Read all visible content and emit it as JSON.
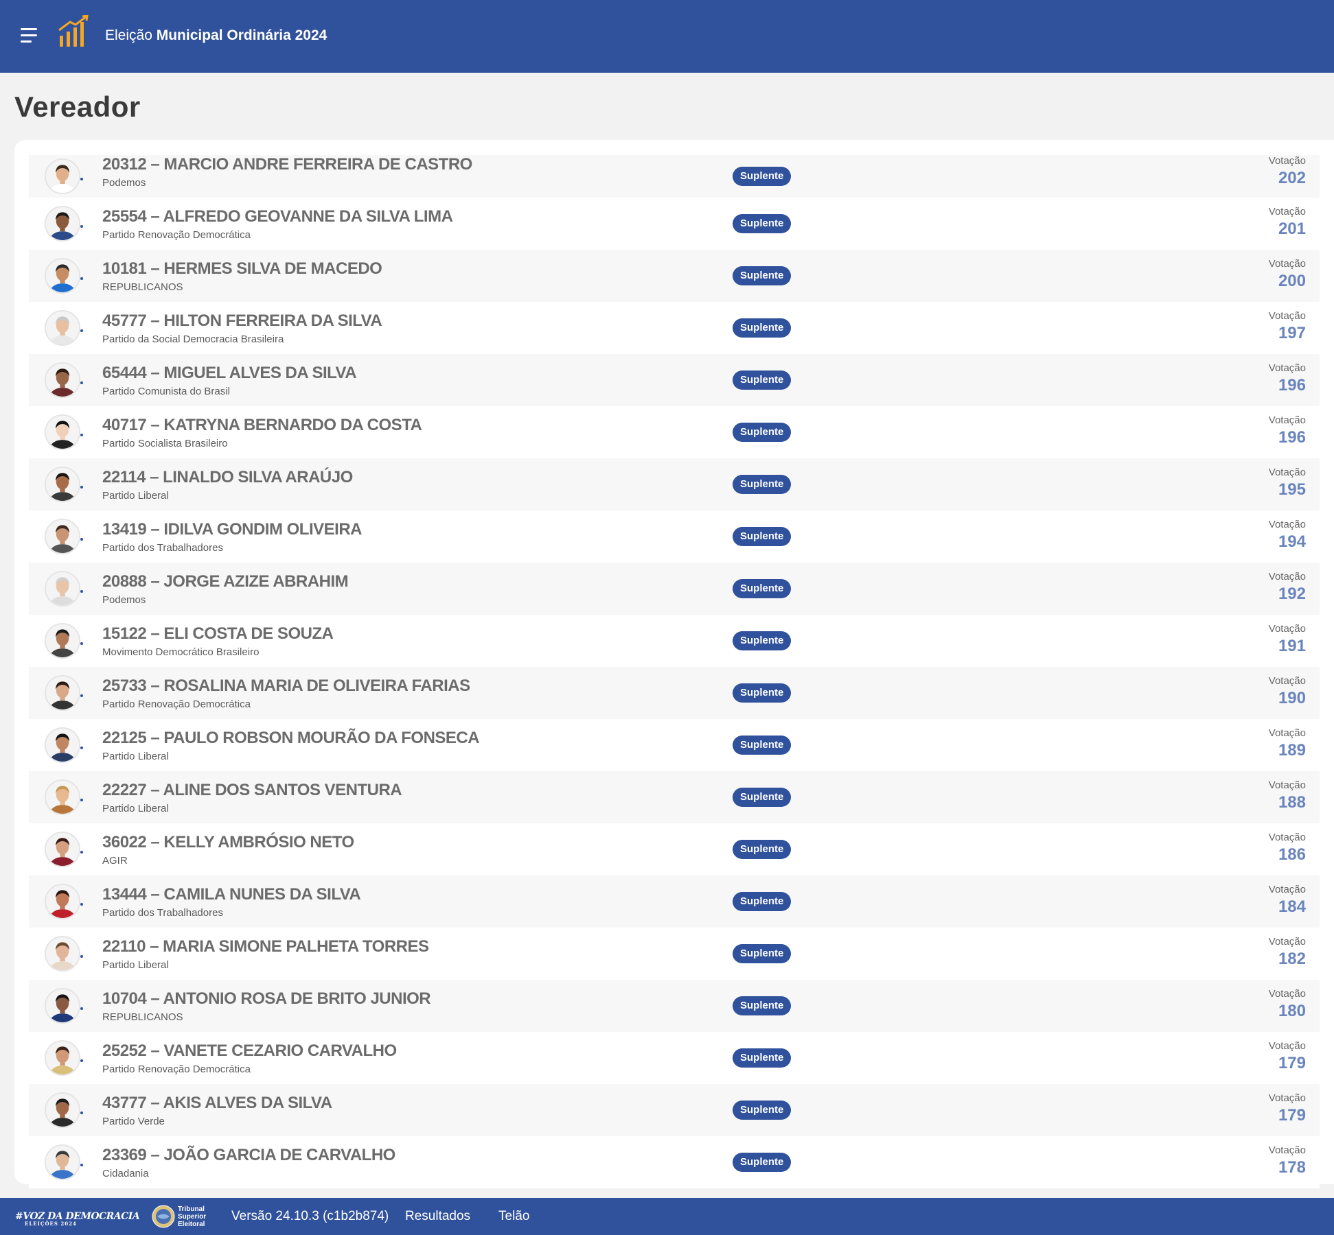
{
  "header": {
    "menu_icon": "hamburger-menu-icon",
    "logo_icon": "bar-chart-growth-icon",
    "title_prefix": "Eleição",
    "title_bold": "Municipal Ordinária 2024"
  },
  "page": {
    "title": "Vereador"
  },
  "list": {
    "votes_label": "Votação",
    "candidates": [
      {
        "name": "20312 – MARCIO ANDRE FERREIRA DE CASTRO",
        "party": "Podemos",
        "status": "Suplente",
        "votes": "202"
      },
      {
        "name": "25554 – ALFREDO GEOVANNE DA SILVA LIMA",
        "party": "Partido Renovação Democrática",
        "status": "Suplente",
        "votes": "201"
      },
      {
        "name": "10181 – HERMES SILVA DE MACEDO",
        "party": "REPUBLICANOS",
        "status": "Suplente",
        "votes": "200"
      },
      {
        "name": "45777 – HILTON FERREIRA DA SILVA",
        "party": "Partido da Social Democracia Brasileira",
        "status": "Suplente",
        "votes": "197"
      },
      {
        "name": "65444 – MIGUEL ALVES DA SILVA",
        "party": "Partido Comunista do Brasil",
        "status": "Suplente",
        "votes": "196"
      },
      {
        "name": "40717 – KATRYNA BERNARDO DA COSTA",
        "party": "Partido Socialista Brasileiro",
        "status": "Suplente",
        "votes": "196"
      },
      {
        "name": "22114 – LINALDO SILVA ARAÚJO",
        "party": "Partido Liberal",
        "status": "Suplente",
        "votes": "195"
      },
      {
        "name": "13419 – IDILVA GONDIM OLIVEIRA",
        "party": "Partido dos Trabalhadores",
        "status": "Suplente",
        "votes": "194"
      },
      {
        "name": "20888 – JORGE AZIZE ABRAHIM",
        "party": "Podemos",
        "status": "Suplente",
        "votes": "192"
      },
      {
        "name": "15122 – ELI COSTA DE SOUZA",
        "party": "Movimento Democrático Brasileiro",
        "status": "Suplente",
        "votes": "191"
      },
      {
        "name": "25733 – ROSALINA MARIA DE OLIVEIRA FARIAS",
        "party": "Partido Renovação Democrática",
        "status": "Suplente",
        "votes": "190"
      },
      {
        "name": "22125 – PAULO ROBSON MOURÃO DA FONSECA",
        "party": "Partido Liberal",
        "status": "Suplente",
        "votes": "189"
      },
      {
        "name": "22227 – ALINE DOS SANTOS VENTURA",
        "party": "Partido Liberal",
        "status": "Suplente",
        "votes": "188"
      },
      {
        "name": "36022 – KELLY AMBRÓSIO NETO",
        "party": "AGIR",
        "status": "Suplente",
        "votes": "186"
      },
      {
        "name": "13444 – CAMILA NUNES DA SILVA",
        "party": "Partido dos Trabalhadores",
        "status": "Suplente",
        "votes": "184"
      },
      {
        "name": "22110 – MARIA SIMONE PALHETA TORRES",
        "party": "Partido Liberal",
        "status": "Suplente",
        "votes": "182"
      },
      {
        "name": "10704 – ANTONIO ROSA DE BRITO JUNIOR",
        "party": "REPUBLICANOS",
        "status": "Suplente",
        "votes": "180"
      },
      {
        "name": "25252 – VANETE CEZARIO CARVALHO",
        "party": "Partido Renovação Democrática",
        "status": "Suplente",
        "votes": "179"
      },
      {
        "name": "43777 – AKIS ALVES DA SILVA",
        "party": "Partido Verde",
        "status": "Suplente",
        "votes": "179"
      },
      {
        "name": "23369 – JOÃO GARCIA DE CARVALHO",
        "party": "Cidadania",
        "status": "Suplente",
        "votes": "178"
      }
    ]
  },
  "footer": {
    "logo_text": "#VOZ DA DEMOCRACIA",
    "logo_sub": "ELEIÇÕES 2024",
    "tse_line1": "Tribunal",
    "tse_line2": "Superior",
    "tse_line3": "Eleitoral",
    "version": "Versão 24.10.3 (c1b2b874)",
    "link_results": "Resultados",
    "link_telao": "Telão"
  },
  "colors": {
    "brand": "#30519b",
    "accent": "#f5a623",
    "votes": "#6a84bd"
  }
}
